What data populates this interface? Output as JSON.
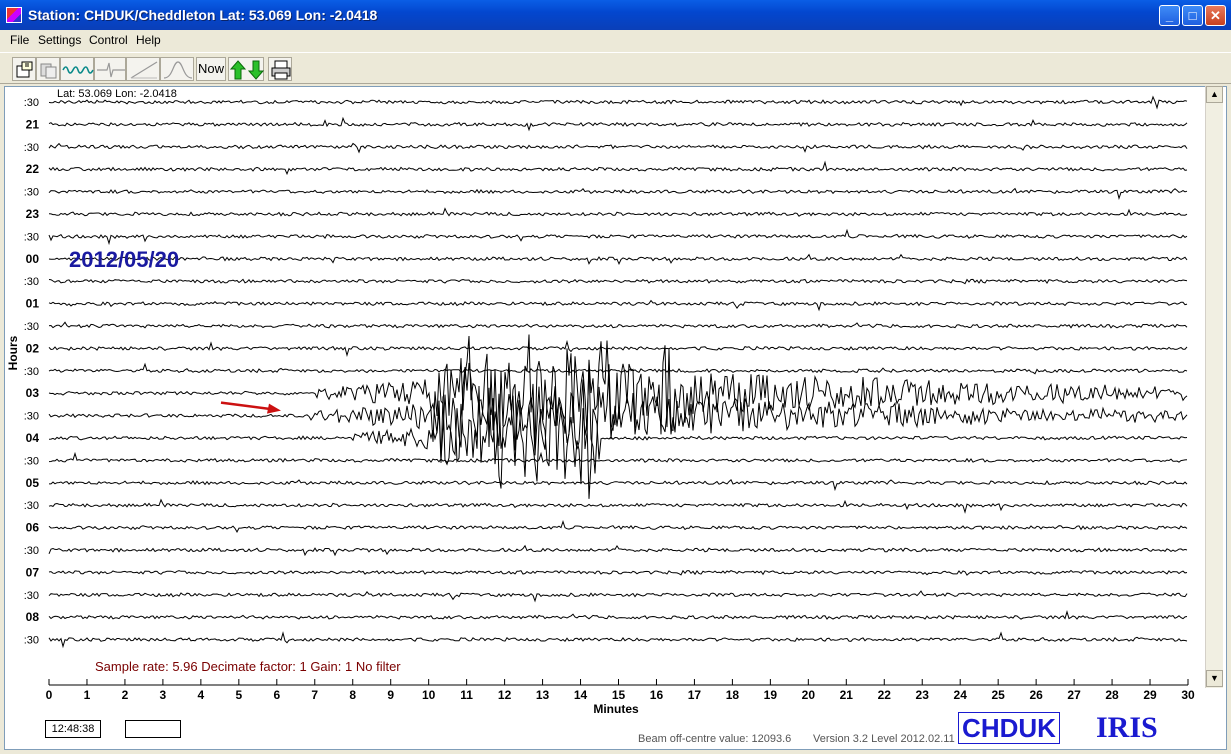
{
  "window": {
    "title": "Station: CHDUK/Cheddleton Lat: 53.069 Lon: -2.0418",
    "minimize_label": "_",
    "maximize_label": "□",
    "close_label": "✕"
  },
  "menu": [
    "File",
    "Settings",
    "Control",
    "Help"
  ],
  "toolbar": {
    "icons": [
      "open-file-icon",
      "copy-icon",
      "waveform-icon",
      "spike-icon",
      "slope-icon",
      "bell-curve-icon"
    ],
    "now_label": "Now",
    "arrows_icon": "up-down-arrows-icon",
    "print_icon": "printer-icon"
  },
  "plot": {
    "station_coords": "Lat: 53.069 Lon: -2.0418",
    "date_label": "2012/05/20",
    "status": "Sample rate: 5.96  Decimate factor: 1  Gain: 1  No filter",
    "y_axis_label": "Hours",
    "x_axis_label": "Minutes",
    "row_labels": [
      ":30",
      "21",
      ":30",
      "22",
      ":30",
      "23",
      ":30",
      "00",
      ":30",
      "01",
      ":30",
      "02",
      ":30",
      "03",
      ":30",
      "04",
      ":30",
      "05",
      ":30",
      "06",
      ":30",
      "07",
      ":30",
      "08",
      ":30"
    ],
    "x_ticks": [
      "0",
      "1",
      "2",
      "3",
      "4",
      "5",
      "6",
      "7",
      "8",
      "9",
      "10",
      "11",
      "12",
      "13",
      "14",
      "15",
      "16",
      "17",
      "18",
      "19",
      "20",
      "21",
      "22",
      "23",
      "24",
      "25",
      "26",
      "27",
      "28",
      "29",
      "30"
    ],
    "colors": {
      "trace": "#000000",
      "date": "#1a1aa0",
      "status": "#7a0000",
      "arrow": "#cc1111",
      "logo": "#1a1ad0"
    }
  },
  "chart_data": {
    "type": "line",
    "title": "",
    "xlabel": "Minutes",
    "ylabel": "Hours",
    "xlim": [
      0,
      30
    ],
    "rows": 25,
    "annotation": "2012/05/20",
    "event_rows": [
      {
        "row": 14,
        "onset_minute": 6.9,
        "coda_end_minute": 30,
        "peak_start": 10.2,
        "peak_end": 14.8
      },
      {
        "row": 13,
        "onset_minute": 7.0,
        "coda_end_minute": 30,
        "peak_start": 10.0,
        "peak_end": 17.0
      },
      {
        "row": 15,
        "onset_minute": 8.0,
        "coda_end_minute": 14.5,
        "peak_start": 10.2,
        "peak_end": 14.5
      }
    ]
  },
  "footer": {
    "time": "12:48:38",
    "empty_box": "",
    "beam": "Beam off-centre value: 12093.6",
    "version": "Version 3.2 Level 2012.02.11",
    "logo_text": "CHDUK",
    "iris_text": "IRIS"
  }
}
